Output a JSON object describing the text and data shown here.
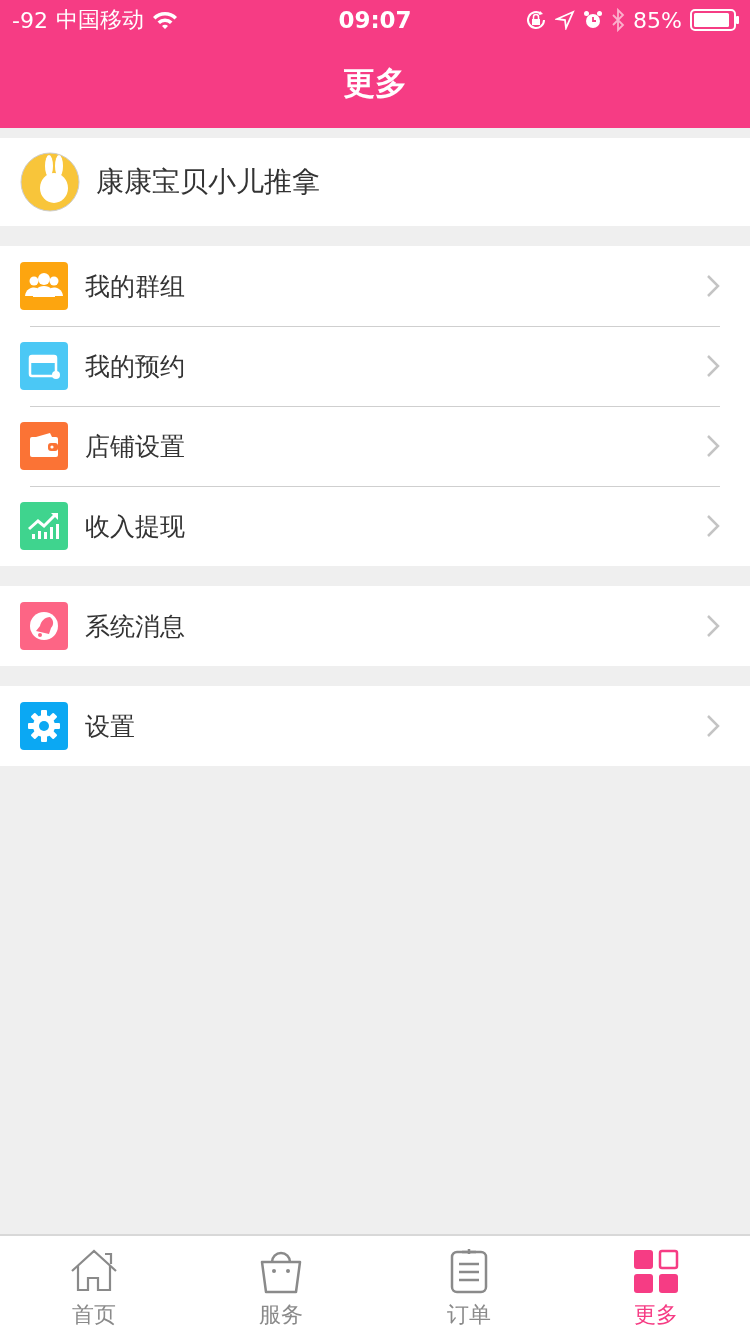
{
  "status_bar": {
    "signal": "-92",
    "carrier": "中国移动",
    "time": "09:07",
    "battery": "85%"
  },
  "header": {
    "title": "更多"
  },
  "profile": {
    "name": "康康宝贝小儿推拿"
  },
  "groups": [
    {
      "items": [
        {
          "kind": "group",
          "label": "我的群组",
          "color": "#fda50f"
        },
        {
          "kind": "booking",
          "label": "我的预约",
          "color": "#4bc8f5"
        },
        {
          "kind": "wallet",
          "label": "店铺设置",
          "color": "#fb7335"
        },
        {
          "kind": "chart",
          "label": "收入提现",
          "color": "#3fd48e"
        }
      ]
    },
    {
      "items": [
        {
          "kind": "bell",
          "label": "系统消息",
          "color": "#fd6585"
        }
      ]
    },
    {
      "items": [
        {
          "kind": "gear",
          "label": "设置",
          "color": "#0ba8f3"
        }
      ]
    }
  ],
  "tabs": [
    {
      "kind": "home",
      "label": "首页",
      "selected": false
    },
    {
      "kind": "bag",
      "label": "服务",
      "selected": false
    },
    {
      "kind": "clipboard",
      "label": "订单",
      "selected": false
    },
    {
      "kind": "grid",
      "label": "更多",
      "selected": true
    }
  ]
}
